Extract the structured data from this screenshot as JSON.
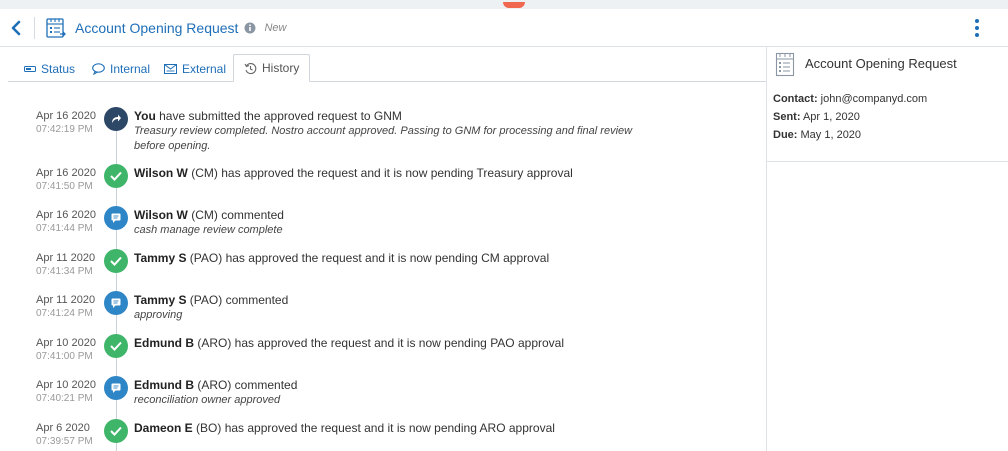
{
  "header": {
    "title": "Account Opening Request",
    "status": "New"
  },
  "tabs": [
    {
      "label": "Status",
      "icon": "status-icon"
    },
    {
      "label": "Internal",
      "icon": "speech-bubble-icon"
    },
    {
      "label": "External",
      "icon": "mail-icon"
    },
    {
      "label": "History",
      "icon": "history-icon",
      "active": true
    }
  ],
  "events": [
    {
      "date": "Apr 16 2020",
      "time": "07:42:19 PM",
      "type": "submit",
      "actor": "You",
      "role": "",
      "text": " have submitted the approved request to GNM",
      "note": "Treasury review completed. Nostro account approved. Passing to GNM for processing and final review before opening."
    },
    {
      "date": "Apr 16 2020",
      "time": "07:41:50 PM",
      "type": "approve",
      "actor": "Wilson W",
      "role": " (CM)",
      "text": " has approved the request and it is now pending Treasury approval",
      "note": ""
    },
    {
      "date": "Apr 16 2020",
      "time": "07:41:44 PM",
      "type": "comment",
      "actor": "Wilson W",
      "role": " (CM)",
      "text": " commented",
      "note": "cash manage review complete"
    },
    {
      "date": "Apr 11 2020",
      "time": "07:41:34 PM",
      "type": "approve",
      "actor": "Tammy S",
      "role": " (PAO)",
      "text": " has approved the request and it is now pending CM approval",
      "note": ""
    },
    {
      "date": "Apr 11 2020",
      "time": "07:41:24 PM",
      "type": "comment",
      "actor": "Tammy S",
      "role": " (PAO)",
      "text": " commented",
      "note": "approving"
    },
    {
      "date": "Apr 10 2020",
      "time": "07:41:00 PM",
      "type": "approve",
      "actor": "Edmund B",
      "role": " (ARO)",
      "text": " has approved the request and it is now pending PAO approval",
      "note": ""
    },
    {
      "date": "Apr 10 2020",
      "time": "07:40:21 PM",
      "type": "comment",
      "actor": "Edmund B",
      "role": " (ARO)",
      "text": " commented",
      "note": "reconciliation owner approved"
    },
    {
      "date": "Apr 6 2020",
      "time": "07:39:57 PM",
      "type": "approve",
      "actor": "Dameon E",
      "role": " (BO)",
      "text": " has approved the request and it is now pending ARO approval",
      "note": ""
    }
  ],
  "side": {
    "title": "Account Opening Request",
    "contact_label": "Contact:",
    "contact_value": " john@companyd.com",
    "sent_label": "Sent:",
    "sent_value": " Apr 1, 2020",
    "due_label": "Due:",
    "due_value": " May 1, 2020"
  },
  "colors": {
    "accent": "#1f6fb8",
    "submit": "#2d4766",
    "approve": "#3fb56a",
    "comment": "#2f86c6"
  }
}
